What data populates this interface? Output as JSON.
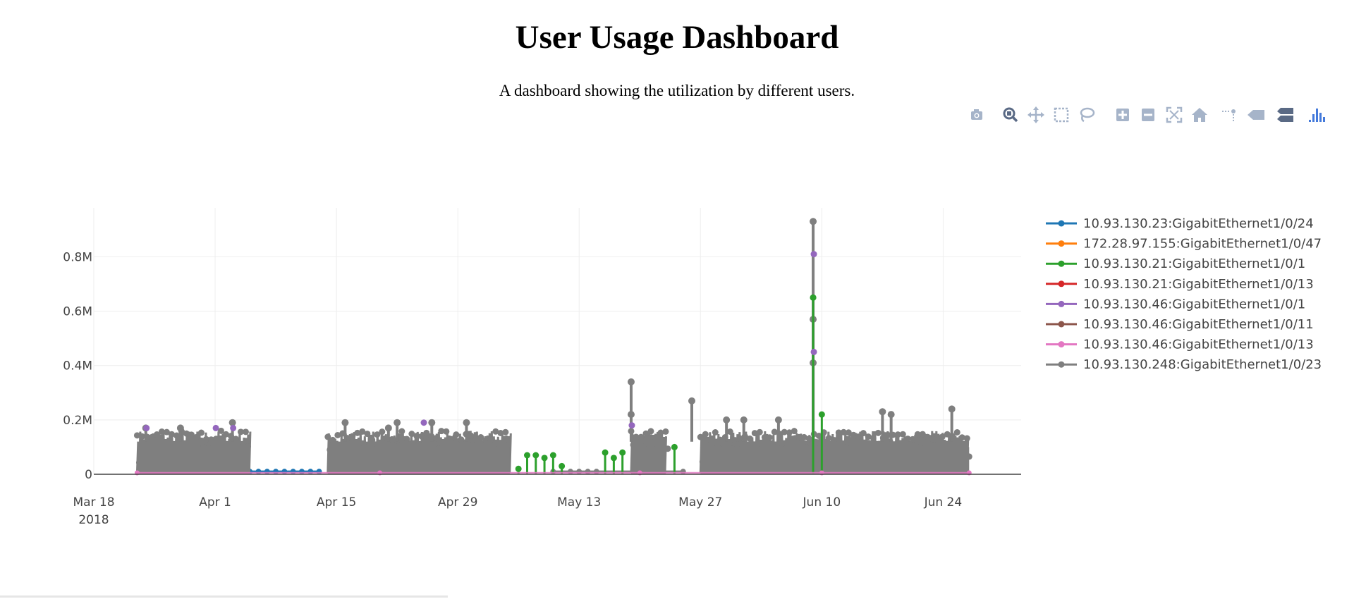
{
  "page": {
    "title": "User Usage Dashboard",
    "subtitle": "A dashboard showing the utilization by different users."
  },
  "modebar": [
    {
      "name": "camera-icon",
      "tooltip": "Download plot as a png"
    },
    {
      "name": "zoom-icon",
      "tooltip": "Zoom"
    },
    {
      "name": "pan-icon",
      "tooltip": "Pan"
    },
    {
      "name": "box-select-icon",
      "tooltip": "Box Select"
    },
    {
      "name": "lasso-select-icon",
      "tooltip": "Lasso Select"
    },
    {
      "name": "zoom-in-icon",
      "tooltip": "Zoom in"
    },
    {
      "name": "zoom-out-icon",
      "tooltip": "Zoom out"
    },
    {
      "name": "autoscale-icon",
      "tooltip": "Autoscale"
    },
    {
      "name": "reset-axes-icon",
      "tooltip": "Reset axes"
    },
    {
      "name": "spike-lines-icon",
      "tooltip": "Toggle Spike Lines"
    },
    {
      "name": "hover-closest-icon",
      "tooltip": "Show closest data on hover"
    },
    {
      "name": "hover-compare-icon",
      "tooltip": "Compare data on hover"
    },
    {
      "name": "plotly-logo-icon",
      "tooltip": "Produced with Plotly"
    }
  ],
  "chart_data": {
    "type": "line",
    "title": "",
    "xlabel": "",
    "ylabel": "",
    "x_range": [
      "2018-03-18",
      "2018-07-03"
    ],
    "ylim": [
      0,
      0.98
    ],
    "y_unit": "M",
    "x_ticks": [
      {
        "date": "2018-03-18",
        "label": "Mar 18",
        "sublabel": "2018"
      },
      {
        "date": "2018-04-01",
        "label": "Apr 1"
      },
      {
        "date": "2018-04-15",
        "label": "Apr 15"
      },
      {
        "date": "2018-04-29",
        "label": "Apr 29"
      },
      {
        "date": "2018-05-13",
        "label": "May 13"
      },
      {
        "date": "2018-05-27",
        "label": "May 27"
      },
      {
        "date": "2018-06-10",
        "label": "Jun 10"
      },
      {
        "date": "2018-06-24",
        "label": "Jun 24"
      }
    ],
    "y_ticks": [
      {
        "value": 0,
        "label": "0"
      },
      {
        "value": 0.2,
        "label": "0.2M"
      },
      {
        "value": 0.4,
        "label": "0.4M"
      },
      {
        "value": 0.6,
        "label": "0.6M"
      },
      {
        "value": 0.8,
        "label": "0.8M"
      }
    ],
    "grid": true,
    "legend_position": "right",
    "series": [
      {
        "name": "10.93.130.23:GigabitEthernet1/0/24",
        "color": "#1f77b4",
        "points": [
          [
            "2018-04-05",
            0.01
          ],
          [
            "2018-04-06",
            0.01
          ],
          [
            "2018-04-07",
            0.01
          ],
          [
            "2018-04-08",
            0.01
          ],
          [
            "2018-04-09",
            0.01
          ],
          [
            "2018-04-10",
            0.01
          ],
          [
            "2018-04-11",
            0.01
          ],
          [
            "2018-04-12",
            0.01
          ],
          [
            "2018-04-13",
            0.01
          ]
        ]
      },
      {
        "name": "172.28.97.155:GigabitEthernet1/0/47",
        "color": "#ff7f0e",
        "points": []
      },
      {
        "name": "10.93.130.21:GigabitEthernet1/0/1",
        "color": "#2ca02c",
        "points": [
          [
            "2018-05-06",
            0.02
          ],
          [
            "2018-05-07",
            0.07
          ],
          [
            "2018-05-08",
            0.07
          ],
          [
            "2018-05-09",
            0.06
          ],
          [
            "2018-05-10",
            0.07
          ],
          [
            "2018-05-11",
            0.03
          ],
          [
            "2018-05-16",
            0.08
          ],
          [
            "2018-05-17",
            0.06
          ],
          [
            "2018-05-18",
            0.08
          ],
          [
            "2018-05-24",
            0.1
          ],
          [
            "2018-06-09",
            0.65
          ],
          [
            "2018-06-10",
            0.22
          ]
        ]
      },
      {
        "name": "10.93.130.21:GigabitEthernet1/0/13",
        "color": "#d62728",
        "points": []
      },
      {
        "name": "10.93.130.46:GigabitEthernet1/0/1",
        "color": "#9467bd",
        "points": [
          [
            "2018-03-24",
            0.17
          ],
          [
            "2018-04-01",
            0.17
          ],
          [
            "2018-04-03",
            0.17
          ],
          [
            "2018-04-25",
            0.19
          ],
          [
            "2018-05-19",
            0.18
          ],
          [
            "2018-06-09",
            0.81
          ],
          [
            "2018-06-09",
            0.45
          ]
        ]
      },
      {
        "name": "10.93.130.46:GigabitEthernet1/0/11",
        "color": "#8c564b",
        "points": []
      },
      {
        "name": "10.93.130.46:GigabitEthernet1/0/13",
        "color": "#e377c2",
        "points": [
          [
            "2018-03-23",
            0.0
          ],
          [
            "2018-04-20",
            0.0
          ],
          [
            "2018-05-20",
            0.0
          ],
          [
            "2018-06-10",
            0.0
          ],
          [
            "2018-06-27",
            0.0
          ]
        ]
      },
      {
        "name": "10.93.130.248:GigabitEthernet1/0/23",
        "color": "#7f7f7f",
        "segments": [
          [
            "2018-03-23",
            "2018-04-05"
          ],
          [
            "2018-04-14",
            "2018-05-05"
          ],
          [
            "2018-05-19",
            "2018-05-23"
          ],
          [
            "2018-05-27",
            "2018-06-27"
          ]
        ],
        "baseline": 0.13,
        "spikes": [
          [
            "2018-03-24",
            0.17
          ],
          [
            "2018-03-28",
            0.17
          ],
          [
            "2018-04-03",
            0.19
          ],
          [
            "2018-04-16",
            0.19
          ],
          [
            "2018-04-21",
            0.17
          ],
          [
            "2018-04-22",
            0.19
          ],
          [
            "2018-04-26",
            0.19
          ],
          [
            "2018-04-30",
            0.19
          ],
          [
            "2018-05-19",
            0.34
          ],
          [
            "2018-05-19",
            0.22
          ],
          [
            "2018-05-26",
            0.27
          ],
          [
            "2018-05-30",
            0.2
          ],
          [
            "2018-06-01",
            0.2
          ],
          [
            "2018-06-05",
            0.2
          ],
          [
            "2018-06-09",
            0.93
          ],
          [
            "2018-06-09",
            0.57
          ],
          [
            "2018-06-09",
            0.41
          ],
          [
            "2018-06-17",
            0.23
          ],
          [
            "2018-06-18",
            0.22
          ],
          [
            "2018-06-25",
            0.24
          ]
        ],
        "low_points": [
          [
            "2018-05-10",
            0.01
          ],
          [
            "2018-05-12",
            0.01
          ],
          [
            "2018-05-13",
            0.01
          ],
          [
            "2018-05-14",
            0.01
          ],
          [
            "2018-05-15",
            0.01
          ],
          [
            "2018-05-25",
            0.01
          ]
        ]
      }
    ]
  }
}
